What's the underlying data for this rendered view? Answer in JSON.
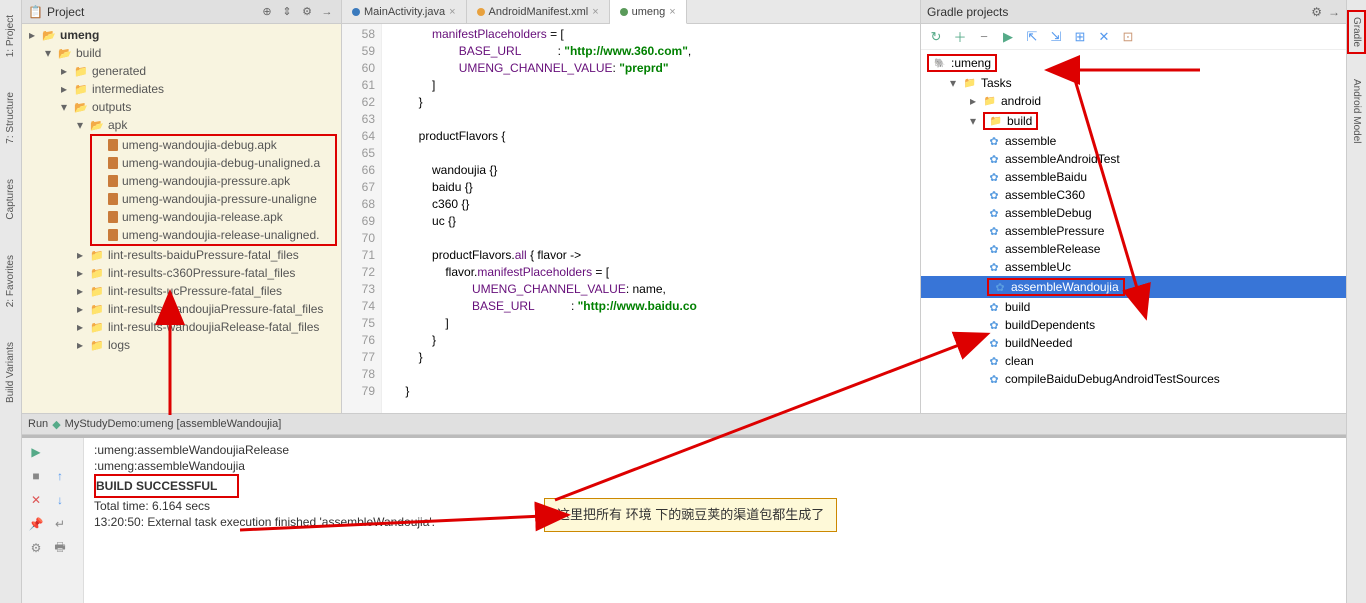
{
  "leftBar": [
    "1: Project",
    "7: Structure",
    "Captures",
    "2: Favorites",
    "Build Variants"
  ],
  "rightBar": [
    "Gradle",
    "Android Model"
  ],
  "projectPanel": {
    "title": "Project",
    "tree": {
      "root": "umeng",
      "build": "build",
      "generated": "generated",
      "intermediates": "intermediates",
      "outputs": "outputs",
      "apk": "apk",
      "apkFiles": [
        "umeng-wandoujia-debug.apk",
        "umeng-wandoujia-debug-unaligned.a",
        "umeng-wandoujia-pressure.apk",
        "umeng-wandoujia-pressure-unaligne",
        "umeng-wandoujia-release.apk",
        "umeng-wandoujia-release-unaligned."
      ],
      "lintDirs": [
        "lint-results-baiduPressure-fatal_files",
        "lint-results-c360Pressure-fatal_files",
        "lint-results-ucPressure-fatal_files",
        "lint-results-wandoujiaPressure-fatal_files",
        "lint-results-wandoujiaRelease-fatal_files"
      ],
      "logs": "logs"
    }
  },
  "tabs": [
    {
      "label": "MainActivity.java",
      "color": "blue"
    },
    {
      "label": "AndroidManifest.xml",
      "color": "orange"
    },
    {
      "label": "umeng",
      "color": "green",
      "active": true
    }
  ],
  "code": {
    "startLine": 58,
    "lines": [
      {
        "indent": "            ",
        "parts": [
          {
            "c": "name",
            "t": "manifestPlaceholders"
          },
          {
            "t": " = ["
          }
        ]
      },
      {
        "indent": "                    ",
        "parts": [
          {
            "c": "name",
            "t": "BASE_URL"
          },
          {
            "t": "           : "
          },
          {
            "c": "str",
            "t": "\"http://www.360.com\""
          },
          {
            "t": ","
          }
        ]
      },
      {
        "indent": "                    ",
        "parts": [
          {
            "c": "name",
            "t": "UMENG_CHANNEL_VALUE"
          },
          {
            "t": ": "
          },
          {
            "c": "str",
            "t": "\"preprd\""
          }
        ]
      },
      {
        "indent": "            ",
        "parts": [
          {
            "t": "]"
          }
        ]
      },
      {
        "indent": "        ",
        "parts": [
          {
            "t": "}"
          }
        ]
      },
      {
        "indent": "",
        "parts": []
      },
      {
        "indent": "        ",
        "parts": [
          {
            "c": "fn",
            "t": "productFlavors {"
          }
        ]
      },
      {
        "indent": "",
        "parts": []
      },
      {
        "indent": "            ",
        "parts": [
          {
            "c": "fn",
            "t": "wandoujia {}"
          }
        ]
      },
      {
        "indent": "            ",
        "parts": [
          {
            "c": "fn",
            "t": "baidu {}"
          }
        ]
      },
      {
        "indent": "            ",
        "parts": [
          {
            "c": "fn",
            "t": "c360 {}"
          }
        ]
      },
      {
        "indent": "            ",
        "parts": [
          {
            "c": "fn",
            "t": "uc {}"
          }
        ]
      },
      {
        "indent": "",
        "parts": []
      },
      {
        "indent": "            ",
        "parts": [
          {
            "c": "fn",
            "t": "productFlavors."
          },
          {
            "c": "name",
            "t": "all"
          },
          {
            "t": " { flavor ->"
          }
        ]
      },
      {
        "indent": "                ",
        "parts": [
          {
            "t": "flavor."
          },
          {
            "c": "name",
            "t": "manifestPlaceholders"
          },
          {
            "t": " = ["
          }
        ]
      },
      {
        "indent": "                        ",
        "parts": [
          {
            "c": "name",
            "t": "UMENG_CHANNEL_VALUE"
          },
          {
            "t": ": name,"
          }
        ]
      },
      {
        "indent": "                        ",
        "parts": [
          {
            "c": "name",
            "t": "BASE_URL"
          },
          {
            "t": "           : "
          },
          {
            "c": "str",
            "t": "\"http://www.baidu.co"
          }
        ]
      },
      {
        "indent": "                ",
        "parts": [
          {
            "t": "]"
          }
        ]
      },
      {
        "indent": "            ",
        "parts": [
          {
            "t": "}"
          }
        ]
      },
      {
        "indent": "        ",
        "parts": [
          {
            "t": "}"
          }
        ]
      },
      {
        "indent": "",
        "parts": []
      },
      {
        "indent": "    ",
        "parts": [
          {
            "t": "}"
          }
        ]
      }
    ]
  },
  "gradle": {
    "title": "Gradle projects",
    "root": ":umeng",
    "tasksLabel": "Tasks",
    "catAndroid": "android",
    "catBuild": "build",
    "tasks": [
      "assemble",
      "assembleAndroidTest",
      "assembleBaidu",
      "assembleC360",
      "assembleDebug",
      "assemblePressure",
      "assembleRelease",
      "assembleUc",
      "assembleWandoujia",
      "build",
      "buildDependents",
      "buildNeeded",
      "clean",
      "compileBaiduDebugAndroidTestSources"
    ],
    "selectedTask": "assembleWandoujia"
  },
  "run": {
    "title": "MyStudyDemo:umeng [assembleWandoujia]",
    "lines": [
      ":umeng:assembleWandoujiaRelease",
      ":umeng:assembleWandoujia",
      "",
      "BUILD SUCCESSFUL",
      "",
      "Total time: 6.164 secs",
      "13:20:50: External task execution finished 'assembleWandoujia'."
    ]
  },
  "annotation": "这里把所有 环境 下的豌豆荚的渠道包都生成了"
}
